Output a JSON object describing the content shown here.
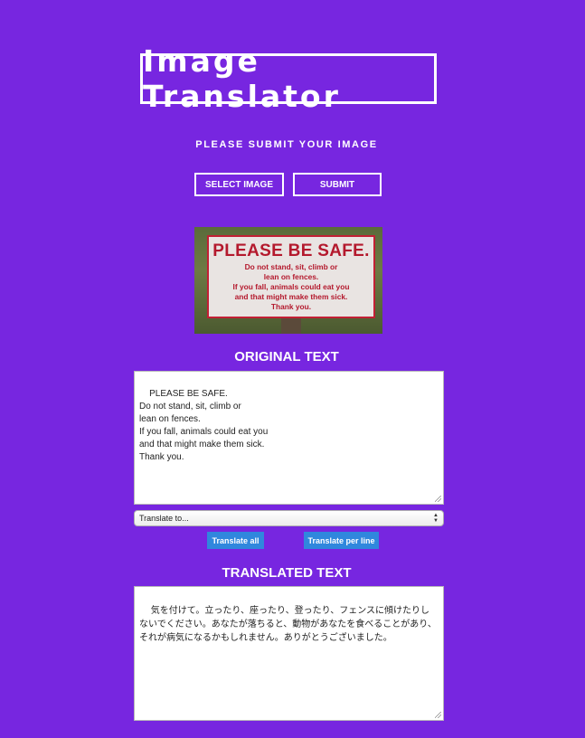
{
  "header": {
    "title": "Image Translator",
    "subtitle": "PLEASE SUBMIT YOUR IMAGE"
  },
  "upload": {
    "select_label": "SELECT IMAGE",
    "submit_label": "SUBMIT"
  },
  "image": {
    "sign_headline": "PLEASE BE SAFE.",
    "sign_lines": [
      "Do not stand, sit, climb or",
      "lean on fences.",
      "If you fall, animals could eat you",
      "and that might make them sick.",
      "Thank you."
    ]
  },
  "original": {
    "heading": "ORIGINAL TEXT",
    "text": "PLEASE BE SAFE.\nDo not stand, sit, climb or\nlean on fences.\nIf you fall, animals could eat you\nand that might make them sick.\nThank you."
  },
  "translate": {
    "select_value": "Translate to...",
    "translate_all_label": "Translate all",
    "translate_per_line_label": "Translate per line"
  },
  "translated": {
    "heading": "TRANSLATED TEXT",
    "text": "気を付けて。立ったり、座ったり、登ったり、フェンスに傾けたりしないでください。あなたが落ちると、動物があなたを食べることがあり、それが病気になるかもしれません。ありがとうございました。"
  },
  "colors": {
    "background": "#7726e0",
    "button_blue": "#3087dd",
    "sign_red": "#b4192d"
  }
}
